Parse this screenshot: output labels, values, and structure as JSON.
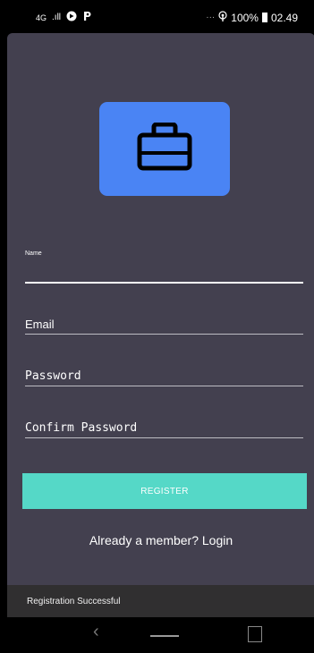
{
  "status_bar": {
    "network": "4G",
    "signal": ".ıll",
    "battery": "100%",
    "time": "02.49"
  },
  "app": {
    "logo_icon": "briefcase-icon",
    "fields": [
      {
        "label": "Name"
      },
      {
        "label": "Email"
      },
      {
        "label": "Password"
      },
      {
        "label": "Confirm Password"
      }
    ],
    "register_label": "REGISTER",
    "login_link": "Already a member? Login"
  },
  "toast": {
    "text": "Registration Successful"
  },
  "colors": {
    "background": "#43404f",
    "logo_bg": "#4a84f4",
    "button": "#55d8c7"
  }
}
